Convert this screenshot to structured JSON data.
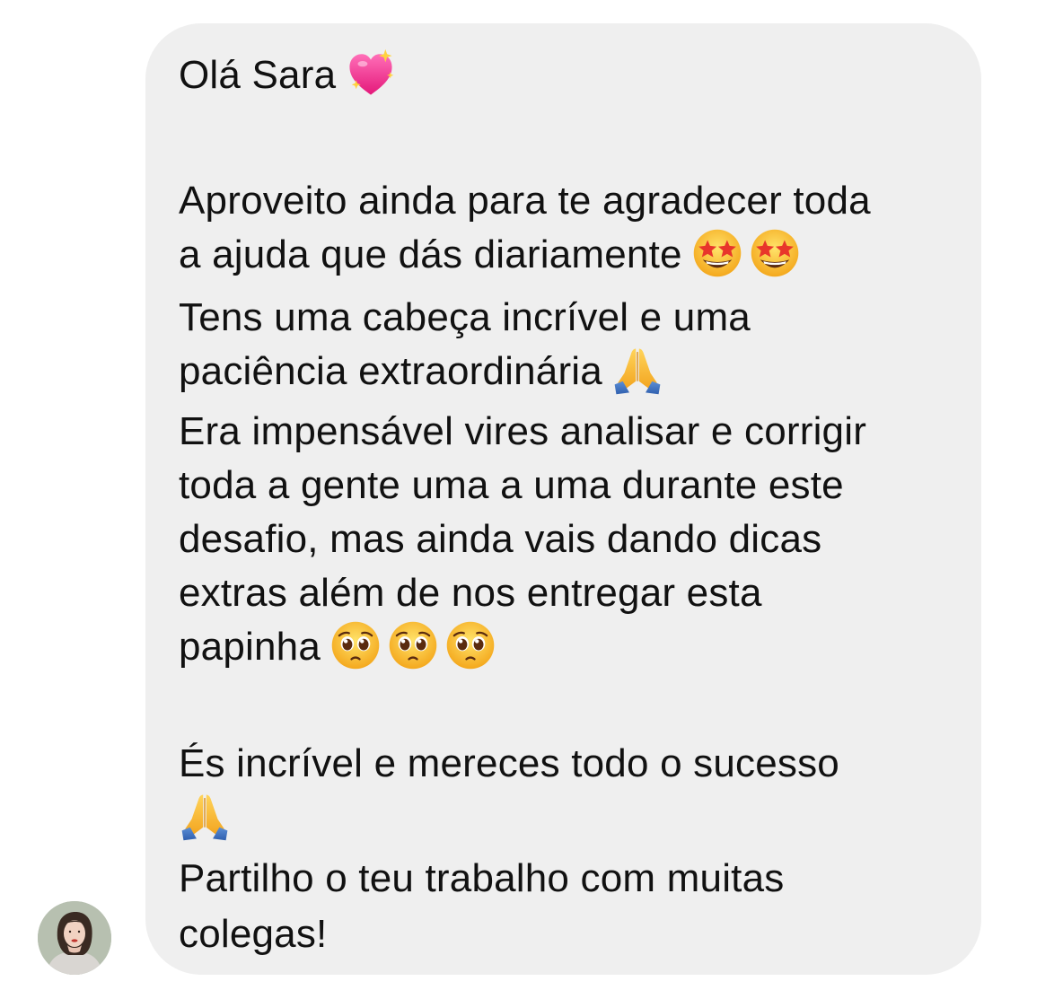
{
  "sender": {
    "avatar_icon": "avatar-portrait-icon"
  },
  "message": {
    "lines": [
      {
        "text": "Olá Sara",
        "emojis": [
          "sparkling-heart-icon"
        ]
      },
      {
        "text": "",
        "emojis": []
      },
      {
        "text": "Aproveito ainda para te agradecer toda",
        "emojis": []
      },
      {
        "text": "a ajuda que dás diariamente",
        "emojis": [
          "star-struck-icon",
          "star-struck-icon"
        ]
      },
      {
        "text": "Tens uma cabeça incrível e uma",
        "emojis": []
      },
      {
        "text": "paciência extraordinária",
        "emojis": [
          "folded-hands-icon"
        ]
      },
      {
        "text": "Era impensável vires analisar e corrigir",
        "emojis": []
      },
      {
        "text": "toda a gente uma a uma durante este",
        "emojis": []
      },
      {
        "text": "desafio, mas ainda vais dando dicas",
        "emojis": []
      },
      {
        "text": "extras além de nos entregar esta",
        "emojis": []
      },
      {
        "text": "papinha",
        "emojis": [
          "pleading-face-icon",
          "pleading-face-icon",
          "pleading-face-icon"
        ]
      },
      {
        "text": "",
        "emojis": []
      },
      {
        "text": "És incrível e mereces todo o sucesso",
        "emojis": []
      },
      {
        "text": "",
        "emojis": [
          "folded-hands-icon"
        ]
      },
      {
        "text": "Partilho o teu trabalho com muitas",
        "emojis": []
      },
      {
        "text": "colegas!",
        "emojis": []
      }
    ]
  },
  "colors": {
    "bubble_background": "#efefef",
    "text": "#111111",
    "page_background": "#ffffff"
  }
}
